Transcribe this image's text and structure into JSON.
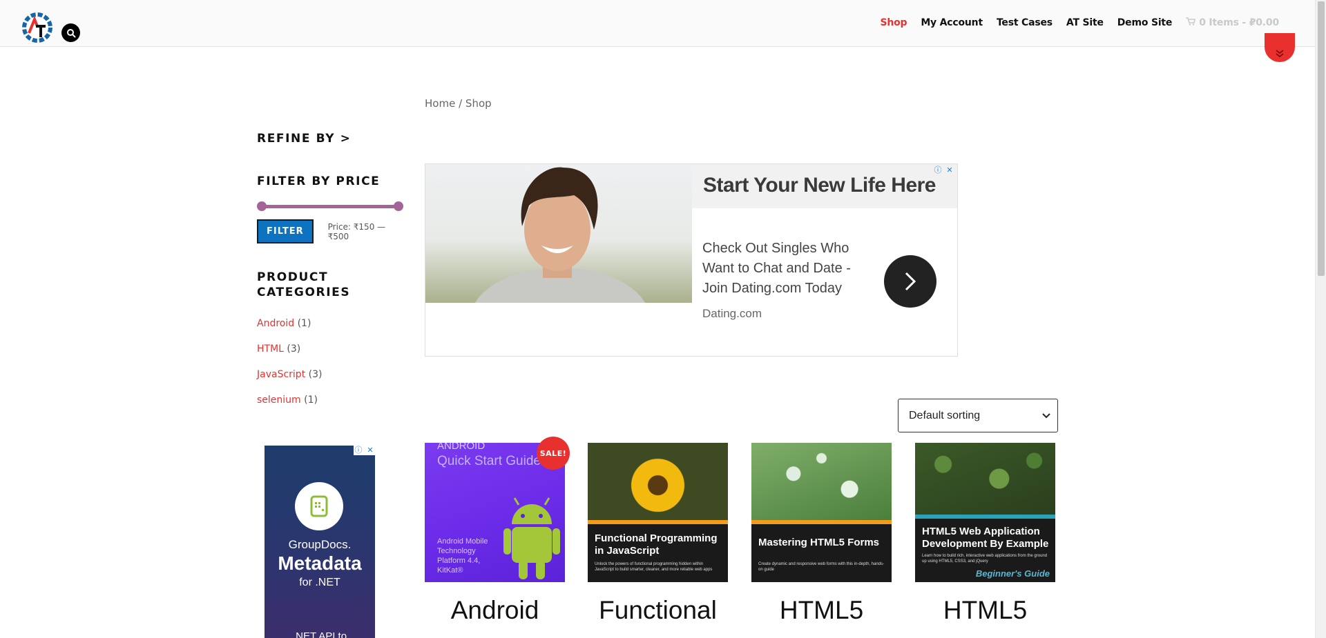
{
  "header": {
    "nav": [
      "Shop",
      "My Account",
      "Test Cases",
      "AT Site",
      "Demo Site"
    ],
    "cart": "0 Items - ₽0.00"
  },
  "breadcrumb": {
    "home": "Home",
    "sep": "/",
    "current": "Shop"
  },
  "sidebar": {
    "refine_title": "REFINE BY >",
    "price_title": "FILTER BY PRICE",
    "filter_button": "FILTER",
    "price_label": "Price: ₹150 — ₹500",
    "price_range": {
      "min": 150,
      "max": 500
    },
    "categories_title": "PRODUCT CATEGORIES",
    "categories": [
      {
        "name": "Android",
        "count": "(1)"
      },
      {
        "name": "HTML",
        "count": "(3)"
      },
      {
        "name": "JavaScript",
        "count": "(3)"
      },
      {
        "name": "selenium",
        "count": "(1)"
      }
    ]
  },
  "ad_top": {
    "title": "Start Your New Life Here",
    "body": "Check Out Singles Who Want to Chat and Date - Join Dating.com Today",
    "domain": "Dating.com"
  },
  "ad_side": {
    "brand": "GroupDocs.",
    "product": "Metadata",
    "platform": "for .NET",
    "tagline": ".NET API to"
  },
  "sort": {
    "selected": "Default sorting"
  },
  "products": [
    {
      "name": "Android",
      "sale": "SALE!",
      "cover_title": "ANDROID",
      "cover_sub": "Quick Start Guide",
      "cover_detail": "Android Mobile Technology Platform 4.4, KitKat®"
    },
    {
      "name": "Functional",
      "cover_title": "Functional Programming in JavaScript",
      "cover_detail": "Unlock the powers of functional programming hidden within JavaScript to build smarter, cleaner, and more reliable web apps"
    },
    {
      "name": "HTML5",
      "cover_title": "Mastering HTML5 Forms",
      "cover_detail": "Create dynamic and responsive web forms with this in-depth, hands-on guide"
    },
    {
      "name": "HTML5",
      "cover_title": "HTML5 Web Application Development By Example",
      "cover_detail": "Learn how to build rich, interactive web applications from the ground up using HTML5, CSS3, and jQuery",
      "cover_series": "Beginner's Guide"
    }
  ],
  "colors": {
    "accent": "#e8302e",
    "button": "#0d72c0",
    "slider": "#a46497"
  }
}
